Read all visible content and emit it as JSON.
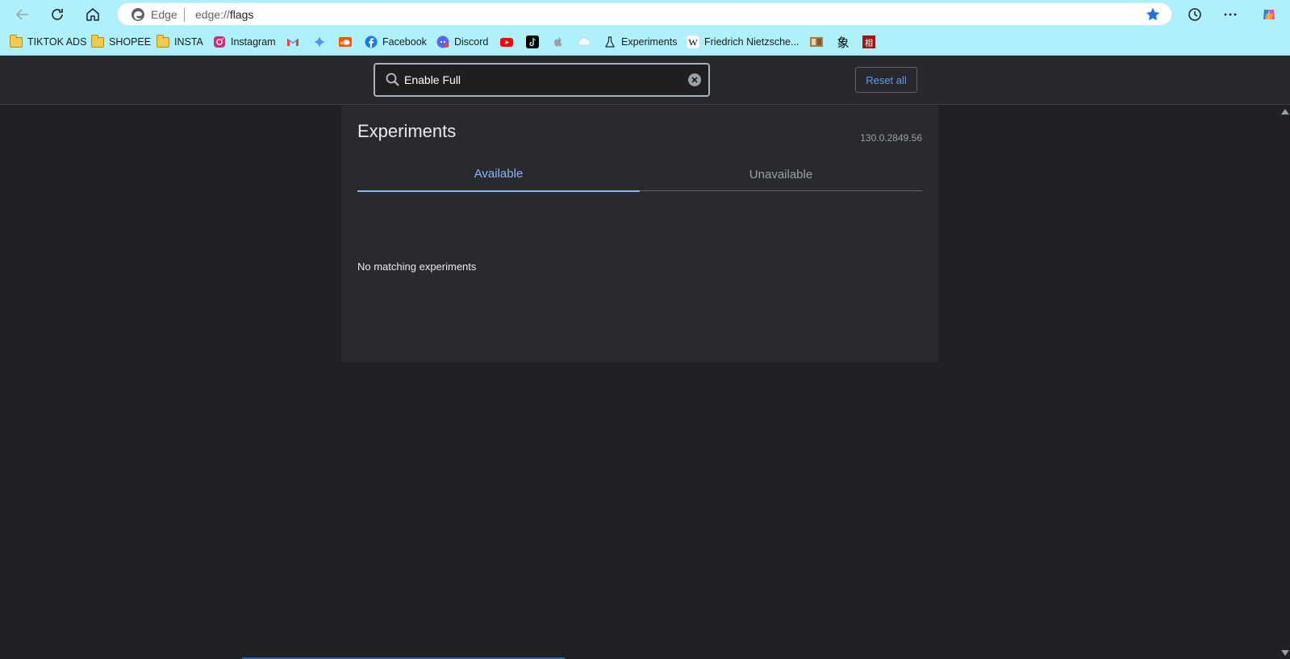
{
  "browser": {
    "site_name": "Edge",
    "url_prefix": "edge://",
    "url_path": "flags",
    "accent_color": "#1a73e8"
  },
  "bookmarks": [
    {
      "label": "TIKTOK ADS",
      "icon": "folder-icon"
    },
    {
      "label": "SHOPEE",
      "icon": "folder-icon"
    },
    {
      "label": "INSTA",
      "icon": "folder-icon"
    },
    {
      "label": "Instagram",
      "icon": "instagram-icon"
    },
    {
      "label": "",
      "icon": "gmail-icon"
    },
    {
      "label": "",
      "icon": "gemini-icon"
    },
    {
      "label": "",
      "icon": "soundcloud-icon"
    },
    {
      "label": "Facebook",
      "icon": "facebook-icon"
    },
    {
      "label": "Discord",
      "icon": "discord-icon"
    },
    {
      "label": "",
      "icon": "youtube-icon"
    },
    {
      "label": "",
      "icon": "tiktok-icon"
    },
    {
      "label": "",
      "icon": "apple-icon"
    },
    {
      "label": "",
      "icon": "cloud-icon"
    },
    {
      "label": "Experiments",
      "icon": "flask-icon"
    },
    {
      "label": "Friedrich Nietzsche...",
      "icon": "wikipedia-icon"
    },
    {
      "label": "",
      "icon": "image-icon"
    },
    {
      "label": "象",
      "icon": "kanji-icon"
    },
    {
      "label": "相",
      "icon": "red-seal-icon"
    }
  ],
  "search": {
    "value": "Enable Full"
  },
  "header": {
    "reset_label": "Reset all"
  },
  "main": {
    "title": "Experiments",
    "version": "130.0.2849.56",
    "tabs": [
      {
        "label": "Available",
        "active": true
      },
      {
        "label": "Unavailable",
        "active": false
      }
    ],
    "empty_message": "No matching experiments"
  }
}
